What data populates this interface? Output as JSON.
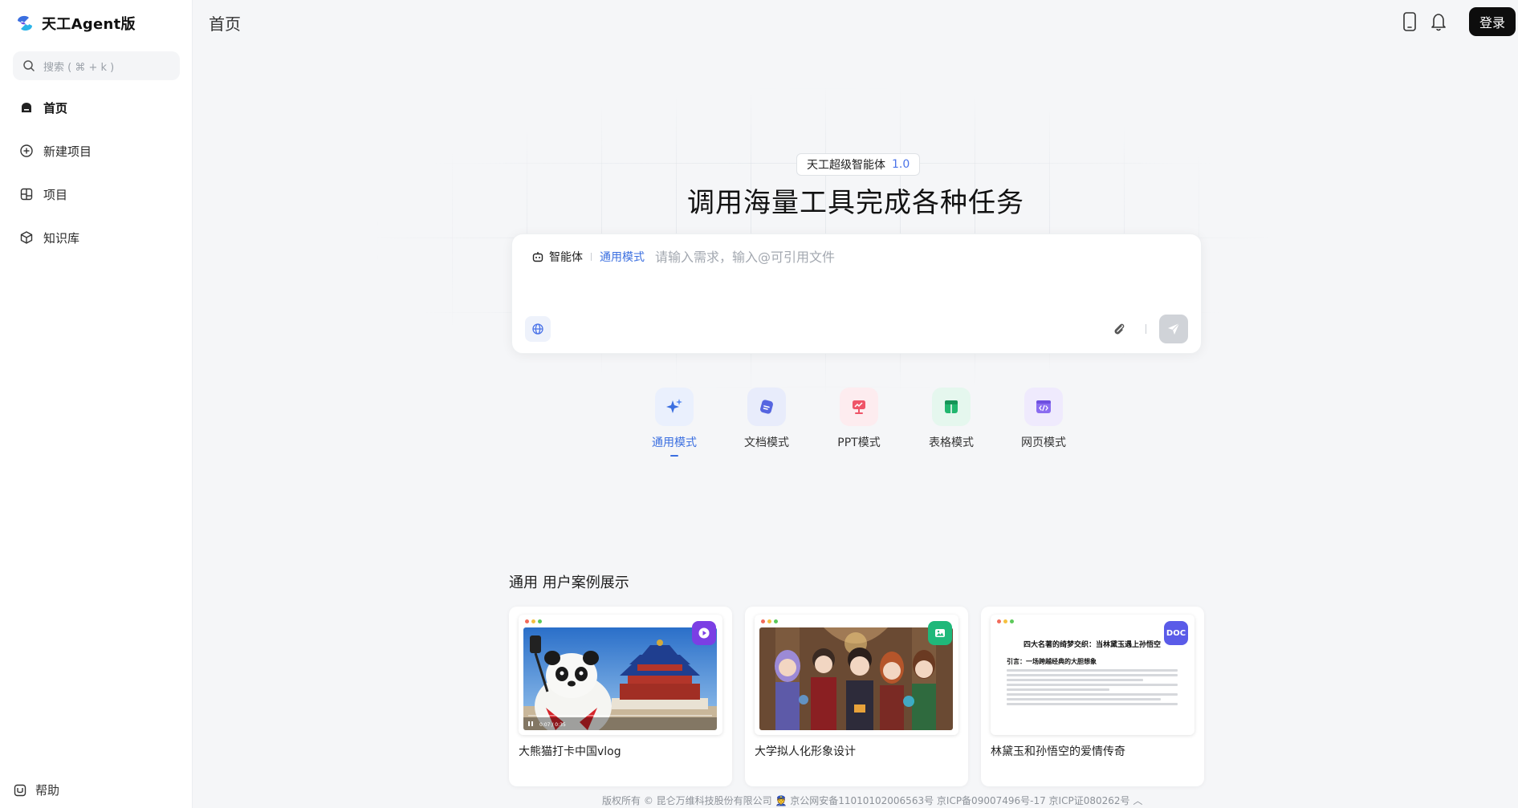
{
  "app": {
    "brand_name": "天工Agent版"
  },
  "sidebar": {
    "search_placeholder": "搜索 ( ⌘ + k )",
    "items": [
      {
        "label": "首页",
        "icon": "home-icon",
        "active": true
      },
      {
        "label": "新建项目",
        "icon": "plus-circle-icon",
        "active": false
      },
      {
        "label": "项目",
        "icon": "project-icon",
        "active": false
      },
      {
        "label": "知识库",
        "icon": "cube-icon",
        "active": false
      }
    ],
    "help_label": "帮助"
  },
  "header": {
    "title": "首页",
    "login_label": "登录"
  },
  "hero": {
    "badge_text": "天工超级智能体",
    "badge_version": "1.0",
    "headline": "调用海量工具完成各种任务"
  },
  "composer": {
    "agent_label": "智能体",
    "mode_label": "通用模式",
    "placeholder": "请输入需求，输入@可引用文件"
  },
  "modes": [
    {
      "label": "通用模式",
      "icon": "sparkle-icon",
      "active": true
    },
    {
      "label": "文档模式",
      "icon": "document-icon",
      "active": false
    },
    {
      "label": "PPT模式",
      "icon": "presentation-icon",
      "active": false
    },
    {
      "label": "表格模式",
      "icon": "table-icon",
      "active": false
    },
    {
      "label": "网页模式",
      "icon": "code-window-icon",
      "active": false
    }
  ],
  "cases": {
    "title": "通用 用户案例展示",
    "items": [
      {
        "title": "大熊猫打卡中国vlog",
        "type": "video",
        "time": "0:07 / 0:35"
      },
      {
        "title": "大学拟人化形象设计",
        "type": "image"
      },
      {
        "title": "林黛玉和孙悟空的爱情传奇",
        "type": "doc",
        "badge": "DOC",
        "doc_title": "四大名著的绮梦交织：当林黛玉遇上孙悟空",
        "doc_heading": "引言：一场跨越经典的大胆想象"
      }
    ]
  },
  "footer": {
    "text": "版权所有 © 昆仑万维科技股份有限公司 👮 京公网安备11010102006563号 京ICP备09007496号-17 京ICP证080262号 ︿"
  },
  "colors": {
    "accent": "#3b6fe0",
    "login_bg": "#0d0d0d",
    "video_badge": "#7b3fe4",
    "image_badge": "#1fb87a",
    "doc_badge": "#5a5be8"
  }
}
